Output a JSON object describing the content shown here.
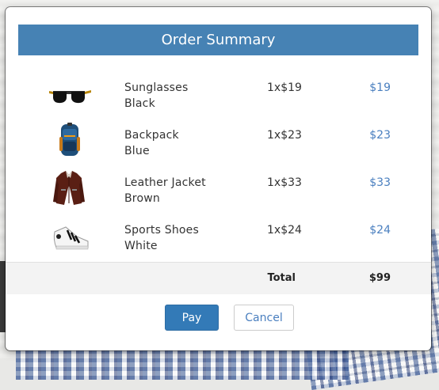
{
  "modal": {
    "title": "Order Summary"
  },
  "items": [
    {
      "name": "Sunglasses",
      "variant": "Black",
      "qty": "1x$19",
      "price": "$19",
      "icon": "sunglasses-icon"
    },
    {
      "name": "Backpack",
      "variant": "Blue",
      "qty": "1x$23",
      "price": "$23",
      "icon": "backpack-icon"
    },
    {
      "name": "Leather Jacket",
      "variant": "Brown",
      "qty": "1x$33",
      "price": "$33",
      "icon": "leather-jacket-icon"
    },
    {
      "name": "Sports Shoes",
      "variant": "White",
      "qty": "1x$24",
      "price": "$24",
      "icon": "sports-shoes-icon"
    }
  ],
  "totals": {
    "label": "Total",
    "value": "$99"
  },
  "actions": {
    "pay_label": "Pay",
    "cancel_label": "Cancel"
  },
  "colors": {
    "header_bg": "#4682b4",
    "price_text": "#4a7fbf",
    "pay_button_bg": "#337ab7"
  }
}
